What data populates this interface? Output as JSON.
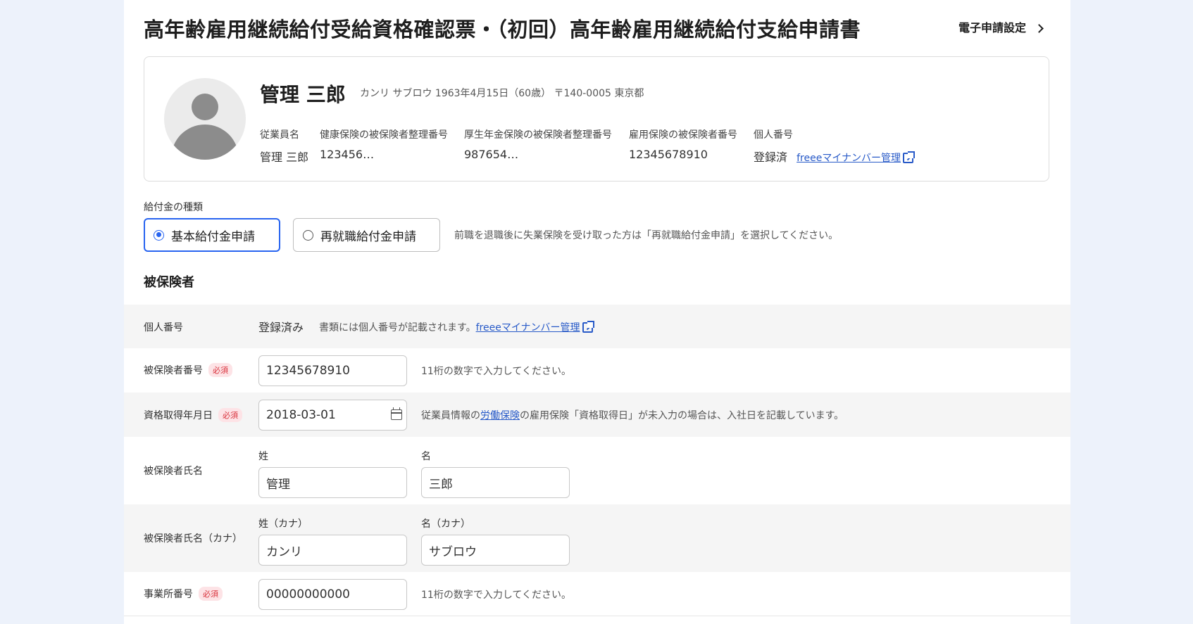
{
  "page": {
    "title": "高年齢雇用継続給付受給資格確認票・（初回）高年齢雇用継続給付支給申請書",
    "e_filing_settings": "電子申請設定"
  },
  "employee_card": {
    "name": "管理 三郎",
    "sub_info": "カンリ サブロウ 1963年4月15日（60歳） 〒140-0005 東京都",
    "columns": [
      {
        "label": "従業員名",
        "value": "管理 三郎"
      },
      {
        "label": "健康保険の被保険者整理番号",
        "value": "123456…"
      },
      {
        "label": "厚生年金保険の被保険者整理番号",
        "value": "987654…"
      },
      {
        "label": "雇用保険の被保険者番号",
        "value": "12345678910"
      },
      {
        "label": "個人番号",
        "value": "登録済",
        "link": "freeeマイナンバー管理"
      }
    ]
  },
  "benefit_type": {
    "label": "給付金の種類",
    "options": [
      "基本給付金申請",
      "再就職給付金申請"
    ],
    "selected": "基本給付金申請",
    "hint": "前職を退職後に失業保険を受け取った方は「再就職給付金申請」を選択してください。"
  },
  "section": {
    "title": "被保険者"
  },
  "required_badge": "必須",
  "form": {
    "my_number": {
      "label": "個人番号",
      "value": "登録済み",
      "hint": "書類には個人番号が記載されます。",
      "link": "freeeマイナンバー管理"
    },
    "insured_number": {
      "label": "被保険者番号",
      "value": "12345678910",
      "hint": "11桁の数字で入力してください。"
    },
    "acquisition_date": {
      "label": "資格取得年月日",
      "value": "2018-03-01",
      "hint_pre": "従業員情報の",
      "hint_link": "労働保険",
      "hint_post": "の雇用保険「資格取得日」が未入力の場合は、入社日を記載しています。"
    },
    "insured_name": {
      "label": "被保険者氏名",
      "last_label": "姓",
      "last_value": "管理",
      "first_label": "名",
      "first_value": "三郎"
    },
    "insured_name_kana": {
      "label": "被保険者氏名（カナ）",
      "last_label": "姓（カナ）",
      "last_value": "カンリ",
      "first_label": "名（カナ）",
      "first_value": "サブロウ"
    },
    "office_number": {
      "label": "事業所番号",
      "value": "00000000000",
      "hint": "11桁の数字で入力してください。"
    }
  },
  "colors": {
    "accent": "#2864f0",
    "link": "#285ac8",
    "required_bg": "#fde3e6",
    "required_fg": "#d9323c",
    "page_bg": "#edf2fb"
  }
}
